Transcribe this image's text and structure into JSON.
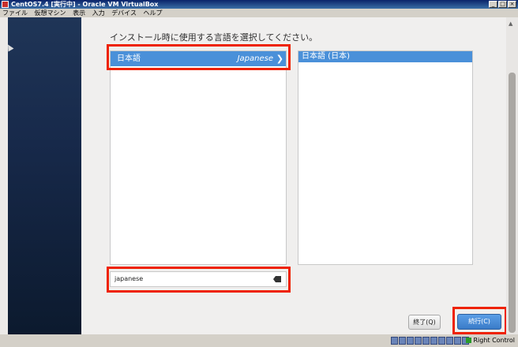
{
  "window": {
    "title": "CentOS7.4 [実行中] - Oracle VM VirtualBox",
    "controls": [
      "_",
      "□",
      "×"
    ]
  },
  "menubar": {
    "items": [
      "ファイル",
      "仮想マシン",
      "表示",
      "入力",
      "デバイス",
      "ヘルプ"
    ]
  },
  "installer": {
    "prompt": "インストール時に使用する言語を選択してください。",
    "language_list": {
      "selected": {
        "native": "日本語",
        "english": "Japanese",
        "chevron": "❯"
      }
    },
    "locale_list": {
      "selected": "日本語 (日本)"
    },
    "search": {
      "value": "japanese"
    },
    "buttons": {
      "quit": "終了(Q)",
      "continue": "続行(C)"
    }
  },
  "statusbar": {
    "host_key": "Right Control"
  },
  "colors": {
    "selection": "#4a90d9",
    "highlight": "#ee2200",
    "sidebar": "#1f3557"
  }
}
